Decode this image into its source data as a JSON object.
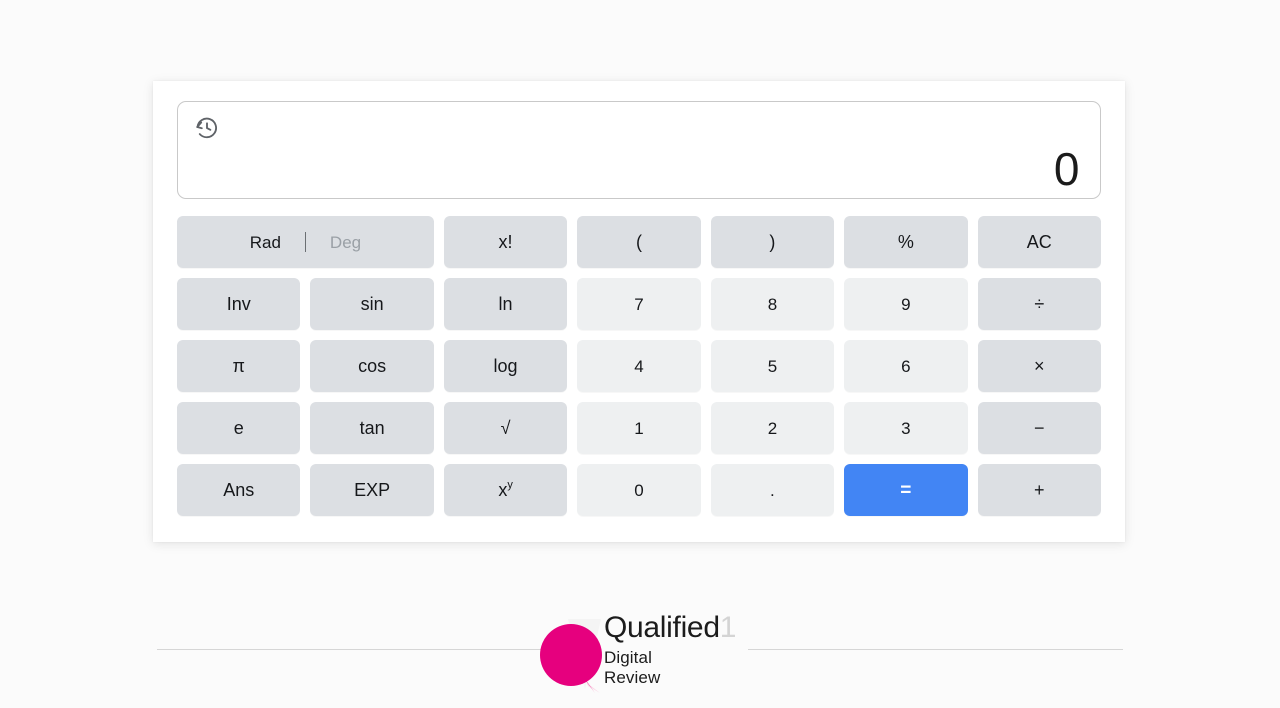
{
  "display": {
    "history_icon": "history-icon",
    "value": "0"
  },
  "angle_mode": {
    "rad_label": "Rad",
    "deg_label": "Deg",
    "divider": "|",
    "active": "Rad"
  },
  "keypad": {
    "rows": [
      [
        {
          "name": "key-angle-toggle",
          "label": "",
          "type": "toggle",
          "span": 2
        },
        {
          "name": "key-factorial",
          "label": "x!",
          "type": "func"
        },
        {
          "name": "key-paren-open",
          "label": "(",
          "type": "func"
        },
        {
          "name": "key-paren-close",
          "label": ")",
          "type": "func"
        },
        {
          "name": "key-percent",
          "label": "%",
          "type": "func"
        },
        {
          "name": "key-all-clear",
          "label": "AC",
          "type": "func"
        }
      ],
      [
        {
          "name": "key-inverse",
          "label": "Inv",
          "type": "func"
        },
        {
          "name": "key-sin",
          "label": "sin",
          "type": "func"
        },
        {
          "name": "key-ln",
          "label": "ln",
          "type": "func"
        },
        {
          "name": "key-7",
          "label": "7",
          "type": "num"
        },
        {
          "name": "key-8",
          "label": "8",
          "type": "num"
        },
        {
          "name": "key-9",
          "label": "9",
          "type": "num"
        },
        {
          "name": "key-divide",
          "label": "÷",
          "type": "op"
        }
      ],
      [
        {
          "name": "key-pi",
          "label": "π",
          "type": "func"
        },
        {
          "name": "key-cos",
          "label": "cos",
          "type": "func"
        },
        {
          "name": "key-log",
          "label": "log",
          "type": "func"
        },
        {
          "name": "key-4",
          "label": "4",
          "type": "num"
        },
        {
          "name": "key-5",
          "label": "5",
          "type": "num"
        },
        {
          "name": "key-6",
          "label": "6",
          "type": "num"
        },
        {
          "name": "key-multiply",
          "label": "×",
          "type": "op"
        }
      ],
      [
        {
          "name": "key-e",
          "label": "e",
          "type": "func"
        },
        {
          "name": "key-tan",
          "label": "tan",
          "type": "func"
        },
        {
          "name": "key-square-root",
          "label": "√",
          "type": "func"
        },
        {
          "name": "key-1",
          "label": "1",
          "type": "num"
        },
        {
          "name": "key-2",
          "label": "2",
          "type": "num"
        },
        {
          "name": "key-3",
          "label": "3",
          "type": "num"
        },
        {
          "name": "key-subtract",
          "label": "−",
          "type": "op"
        }
      ],
      [
        {
          "name": "key-answer",
          "label": "Ans",
          "type": "func"
        },
        {
          "name": "key-exponent-exp",
          "label": "EXP",
          "type": "func"
        },
        {
          "name": "key-power",
          "label": "x",
          "superscript": "y",
          "type": "func"
        },
        {
          "name": "key-0",
          "label": "0",
          "type": "num"
        },
        {
          "name": "key-decimal-point",
          "label": ".",
          "type": "num"
        },
        {
          "name": "key-equals",
          "label": "=",
          "type": "equals"
        },
        {
          "name": "key-add",
          "label": "+",
          "type": "op"
        }
      ]
    ]
  },
  "footer": {
    "logo_title": "Qualified",
    "logo_title_faint": "1",
    "logo_sub_line1": "Digital",
    "logo_sub_line2": "Review",
    "brand_color": "#e6007e"
  }
}
